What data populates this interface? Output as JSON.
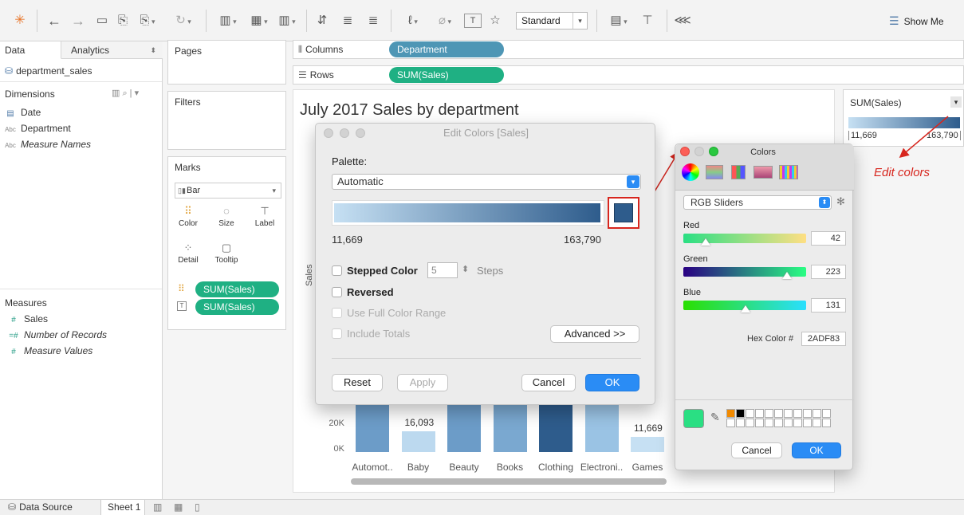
{
  "toolbar": {
    "standard_value": "Standard",
    "show_me_label": "Show Me",
    "icons": [
      "tableau-logo-icon",
      "back-icon",
      "forward-icon",
      "save-icon",
      "new-datasource-icon",
      "datasource-icon",
      "refresh-icon",
      "new-worksheet-icon",
      "new-dashboard-icon",
      "clear-sheet-icon",
      "swap-icon",
      "sort-ascending-icon",
      "sort-descending-icon",
      "highlight-icon",
      "group-icon",
      "show-labels-icon",
      "pin-icon",
      "presentation-icon",
      "share-icon"
    ]
  },
  "data_pane": {
    "tab_data": "Data",
    "tab_analytics": "Analytics",
    "datasource": "department_sales",
    "dimensions_header": "Dimensions",
    "dimensions": [
      {
        "icon": "calendar-icon",
        "label": "Date",
        "italic": false
      },
      {
        "icon": "Abc",
        "label": "Department",
        "italic": false
      },
      {
        "icon": "Abc",
        "label": "Measure Names",
        "italic": true
      }
    ],
    "measures_header": "Measures",
    "measures": [
      {
        "icon": "#",
        "label": "Sales",
        "italic": false
      },
      {
        "icon": "=#",
        "label": "Number of Records",
        "italic": true
      },
      {
        "icon": "#",
        "label": "Measure Values",
        "italic": true
      }
    ]
  },
  "shelves": {
    "pages": "Pages",
    "filters": "Filters",
    "columns_label": "Columns",
    "columns_pill": "Department",
    "rows_label": "Rows",
    "rows_pill": "SUM(Sales)"
  },
  "marks": {
    "title": "Marks",
    "type": "Bar",
    "buttons": [
      "Color",
      "Size",
      "Label",
      "Detail",
      "Tooltip"
    ],
    "pill1": "SUM(Sales)",
    "pill2": "SUM(Sales)"
  },
  "viz": {
    "title": "July 2017 Sales by department",
    "y_axis_label": "Sales",
    "y_ticks": [
      "20K",
      "0K"
    ]
  },
  "chart_data": {
    "type": "bar",
    "categories": [
      "Automot..",
      "Baby",
      "Beauty",
      "Books",
      "Clothing",
      "Electroni..",
      "Games"
    ],
    "values": [
      null,
      16093,
      null,
      null,
      null,
      null,
      11669
    ],
    "data_labels": [
      "",
      "16,093",
      "",
      "",
      "",
      "",
      "11,669"
    ],
    "colors": [
      "#6c9cc8",
      "#bcd9ef",
      "#6c9cc8",
      "#7aa8d0",
      "#2e5c8c",
      "#9ac3e4",
      "#c6e0f3"
    ],
    "ylabel": "Sales",
    "color_range": [
      11669,
      163790
    ]
  },
  "legend": {
    "title": "SUM(Sales)",
    "min": "11,669",
    "max": "163,790"
  },
  "annotation": {
    "text": "Edit colors",
    "color": "#d7261e"
  },
  "edit_colors": {
    "title": "Edit Colors [Sales]",
    "palette_label": "Palette:",
    "palette_value": "Automatic",
    "range_min": "11,669",
    "range_max": "163,790",
    "stepped_label": "Stepped Color",
    "steps_value": "5",
    "steps_label": "Steps",
    "reversed_label": "Reversed",
    "full_range_label": "Use Full Color Range",
    "include_totals_label": "Include Totals",
    "advanced_label": "Advanced >>",
    "reset_label": "Reset",
    "apply_label": "Apply",
    "cancel_label": "Cancel",
    "ok_label": "OK",
    "end_color": "#2e5c8c"
  },
  "colors_panel": {
    "title": "Colors",
    "mode": "RGB Sliders",
    "red_label": "Red",
    "red_value": "42",
    "green_label": "Green",
    "green_value": "223",
    "blue_label": "Blue",
    "blue_value": "131",
    "hex_label": "Hex Color #",
    "hex_value": "2ADF83",
    "cancel_label": "Cancel",
    "ok_label": "OK",
    "current_color": "#2adf83"
  },
  "status_bar": {
    "datasource_tab": "Data Source",
    "sheet_tab": "Sheet 1"
  }
}
